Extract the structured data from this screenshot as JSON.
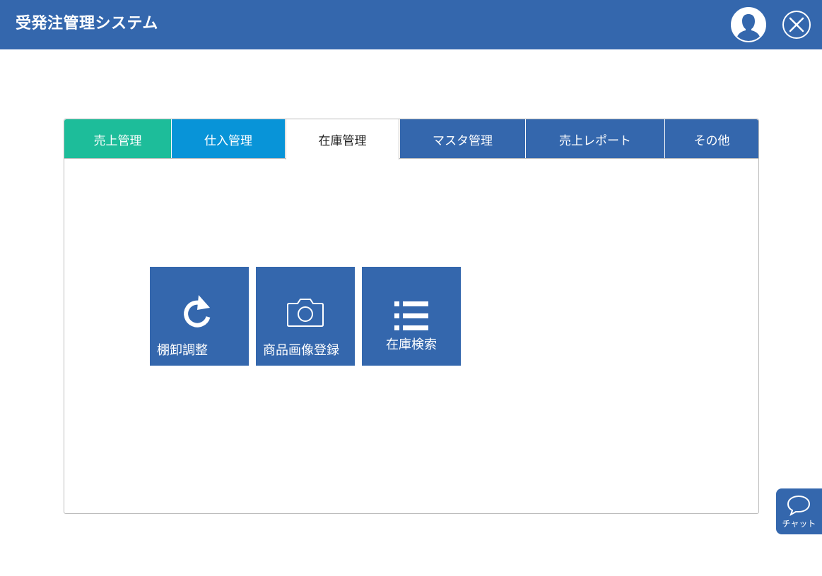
{
  "header": {
    "title": "受発注管理システム",
    "avatar_icon": "user-avatar-icon",
    "close_icon": "close-icon",
    "background": "#3467ad"
  },
  "tabs": [
    {
      "label": "売上管理",
      "color": "#1dbd9a"
    },
    {
      "label": "仕入管理",
      "color": "#0894d8"
    },
    {
      "label": "在庫管理",
      "color": "#ffffff",
      "active": true
    },
    {
      "label": "マスタ管理",
      "color": "#3467ad"
    },
    {
      "label": "売上レポート",
      "color": "#3467ad"
    },
    {
      "label": "その他",
      "color": "#3467ad"
    }
  ],
  "tiles": [
    {
      "label": "棚卸調整",
      "icon": "refresh-icon"
    },
    {
      "label": "商品画像登録",
      "icon": "camera-icon"
    },
    {
      "label": "在庫検索",
      "icon": "list-icon"
    }
  ],
  "chat": {
    "label": "チャット",
    "icon": "speech-bubble-icon"
  }
}
